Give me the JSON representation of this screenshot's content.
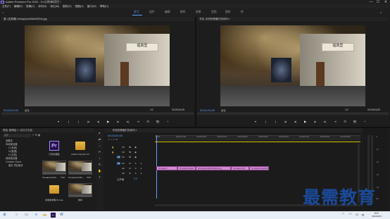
{
  "titlebar": {
    "title": "Adobe Premiere Pro 2020 - D:\\示例\\新项目 *",
    "minimize": "—",
    "maximize": "☐",
    "close": "✕"
  },
  "menu": [
    "文件(F)",
    "编辑(E)",
    "剪辑(C)",
    "序列(S)",
    "标记(M)",
    "图形(G)",
    "视图(V)",
    "窗口(W)",
    "帮助(H)"
  ],
  "workspaces": [
    {
      "label": "学习",
      "active": true
    },
    {
      "label": "组件",
      "active": false
    },
    {
      "label": "编辑",
      "active": false
    },
    {
      "label": "颜色",
      "active": false
    },
    {
      "label": "效果",
      "active": false
    },
    {
      "label": "音频",
      "active": false
    },
    {
      "label": "图形",
      "active": false
    },
    {
      "label": "库",
      "active": false
    }
  ],
  "source_monitor": {
    "tab": "源: (无剪辑)  hmeaprpoint0s0s3004e.jpg",
    "sign": "福興里",
    "timecode_in": "00;00;00;00",
    "fit": "适合",
    "ratio": "1/2",
    "timecode_out": "00;00;04;29"
  },
  "program_monitor": {
    "tab": "节目: 闪光的夜晚灯光序列 ≡",
    "sign": "福興里",
    "timecode_in": "00;00;00;00",
    "fit": "适合",
    "ratio": "1/2",
    "timecode_out": "00;00;04;53"
  },
  "transport_glyphs": [
    "▾",
    "{",
    "}",
    "|◂",
    "◂|",
    "▶",
    "|▸",
    "▸|",
    "⇥",
    "⊡",
    "📷",
    "+"
  ],
  "project": {
    "tabs": [
      "项目: 新项目 ≡",
      "媒体浏览器",
      "库",
      "信息"
    ],
    "search_placeholder": "搜索",
    "tree": [
      "收藏夹",
      "本地驱动器",
      "C:(系统)",
      "D:(数据)",
      "E:(文档)",
      "网络驱动器",
      "Creative Cloud",
      "团队 项目版本"
    ],
    "items": [
      {
        "name": "闪光的夜晚",
        "meta": "",
        "kind": "pr"
      },
      {
        "name": "Adobe Premiere Pr",
        "meta": "",
        "kind": "folder"
      },
      {
        "name": "hmeaprpoint0s...",
        "meta": "5:00",
        "kind": "video"
      },
      {
        "name": "hmeaprpoint0s...",
        "meta": "5:00",
        "kind": "video"
      },
      {
        "name": "新建素材箱 Premie",
        "meta": "",
        "kind": "folder"
      },
      {
        "name": "素材",
        "meta": "",
        "kind": "video2"
      }
    ]
  },
  "tools": [
    "▸",
    "⇄",
    "↔",
    "✂",
    "↕",
    "✎",
    "✋",
    "T"
  ],
  "timeline": {
    "tab": "闪光的夜晚灯光序列 ≡",
    "timecode": "00;00;00;00",
    "ruler_labels": [
      "00;00",
      "00;00;01;00",
      "00;00;02;00",
      "00;00;03;00",
      "00;00;04;00",
      "00;00;05;00",
      "00;00;06;00",
      "00;00;07;00",
      "00;00;08;00",
      "00;00;09;00"
    ],
    "video_tracks": [
      "V3",
      "V2",
      "V1"
    ],
    "audio_tracks": [
      "A1",
      "A2",
      "A3"
    ],
    "master": "主声道",
    "master_value": "0.0",
    "clips": [
      {
        "label": "hmeaprpo"
      },
      {
        "label": "hmeaprpoint0s0"
      },
      {
        "label": "hmeaprpoint0s0s3004e.jpg"
      },
      {
        "label": "hmeaprpoint0"
      },
      {
        "label": "hmeaprpoint0s0s3004"
      }
    ]
  },
  "meter_labels": [
    "0",
    "-12",
    "-24",
    "-36",
    "-48",
    "dB"
  ],
  "taskbar": {
    "time": "8:21",
    "date": "2021/4/24",
    "lang": "中"
  },
  "watermark": "最需教育"
}
